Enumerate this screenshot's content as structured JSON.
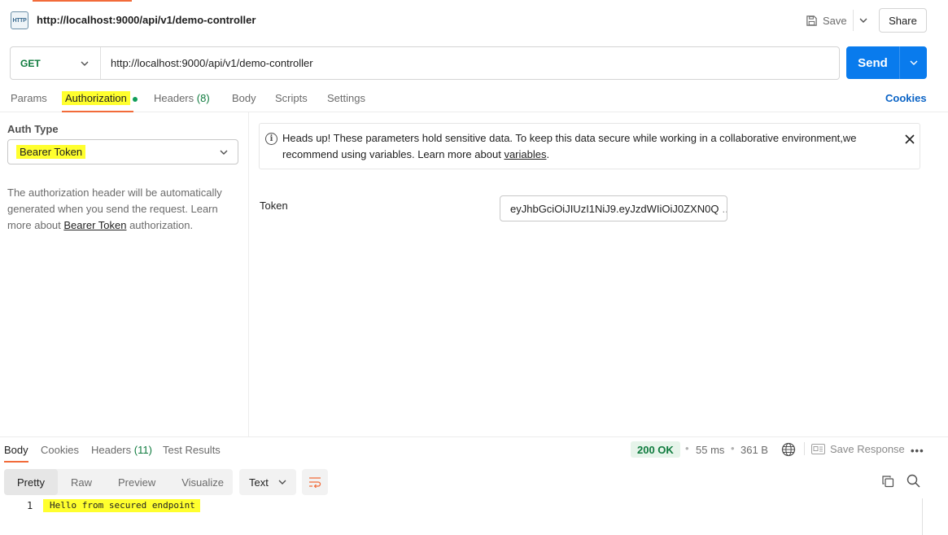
{
  "request": {
    "title": "http://localhost:9000/api/v1/demo-controller",
    "method": "GET",
    "url": "http://localhost:9000/api/v1/demo-controller",
    "icon": "http-icon"
  },
  "toolbar": {
    "save_label": "Save",
    "share_label": "Share",
    "send_label": "Send"
  },
  "tabs": {
    "params": "Params",
    "authorization": "Authorization",
    "headers": "Headers",
    "headers_count": "(8)",
    "body": "Body",
    "scripts": "Scripts",
    "settings": "Settings",
    "cookies": "Cookies"
  },
  "auth": {
    "type_label": "Auth Type",
    "type_value": "Bearer Token",
    "desc_before": "The authorization header will be automatically generated when you send the request. Learn more about ",
    "desc_link": "Bearer Token",
    "desc_after": " authorization.",
    "alert_text": "Heads up! These parameters hold sensitive data. To keep this data secure while working in a collaborative environment,we recommend using variables. Learn more about ",
    "alert_link": "variables",
    "alert_end": ".",
    "token_label": "Token",
    "token_value": "eyJhbGciOiJIUzI1NiJ9.eyJzdWIiOiJ0ZXN0Q",
    "token_ellipsis": "..."
  },
  "response": {
    "tabs": {
      "body": "Body",
      "cookies": "Cookies",
      "headers": "Headers",
      "headers_count": "(11)",
      "test_results": "Test Results"
    },
    "status": "200 OK",
    "time": "55 ms",
    "size": "361 B",
    "save_response": "Save Response",
    "views": [
      "Pretty",
      "Raw",
      "Preview",
      "Visualize"
    ],
    "format": "Text",
    "line_number": "1",
    "content": "Hello from secured endpoint"
  },
  "colors": {
    "accent": "#f26b3a",
    "send": "#097bed",
    "method": "#0f7b3e",
    "highlight": "#ffff2e",
    "link": "#0b64c6"
  }
}
